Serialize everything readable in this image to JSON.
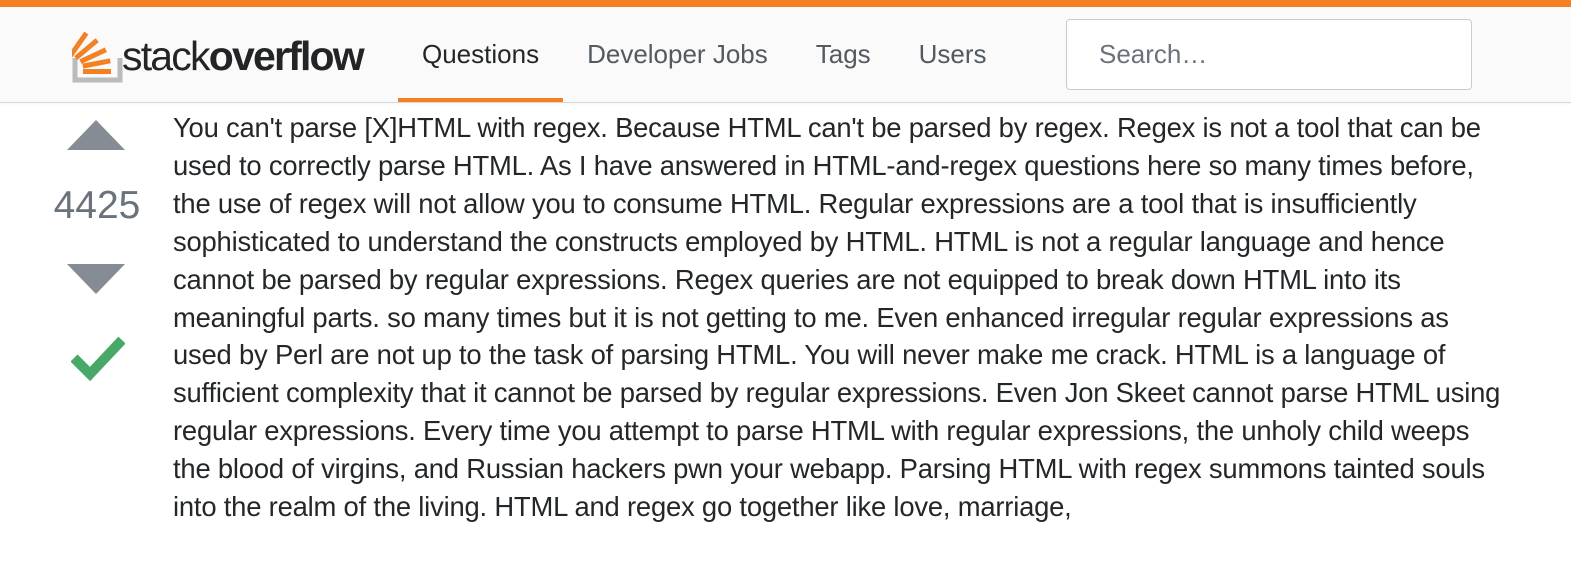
{
  "colors": {
    "accent": "#f48024",
    "vote_arrow": "#858c93",
    "accepted": "#48a868",
    "text": "#242729"
  },
  "header": {
    "logo": {
      "icon": "stackoverflow-logo-icon",
      "text_light": "stack",
      "text_bold": "overflow"
    },
    "nav": [
      {
        "label": "Questions",
        "active": true
      },
      {
        "label": "Developer Jobs",
        "active": false
      },
      {
        "label": "Tags",
        "active": false
      },
      {
        "label": "Users",
        "active": false
      }
    ],
    "search": {
      "placeholder": "Search…",
      "value": ""
    }
  },
  "answer": {
    "votes": "4425",
    "accepted": true,
    "icons": {
      "upvote": "arrow-up-icon",
      "downvote": "arrow-down-icon",
      "accepted": "checkmark-icon"
    },
    "body": "You can't parse [X]HTML with regex. Because HTML can't be parsed by regex. Regex is not a tool that can be used to correctly parse HTML. As I have answered in HTML-and-regex questions here so many times before, the use of regex will not allow you to consume HTML. Regular expressions are a tool that is insufficiently sophisticated to understand the constructs employed by HTML. HTML is not a regular language and hence cannot be parsed by regular expressions. Regex queries are not equipped to break down HTML into its meaningful parts. so many times but it is not getting to me. Even enhanced irregular regular expressions as used by Perl are not up to the task of parsing HTML. You will never make me crack. HTML is a language of sufficient complexity that it cannot be parsed by regular expressions. Even Jon Skeet cannot parse HTML using regular expressions. Every time you attempt to parse HTML with regular expressions, the unholy child weeps the blood of virgins, and Russian hackers pwn your webapp. Parsing HTML with regex summons tainted souls into the realm of the living. HTML and regex go together like love, marriage,"
  }
}
